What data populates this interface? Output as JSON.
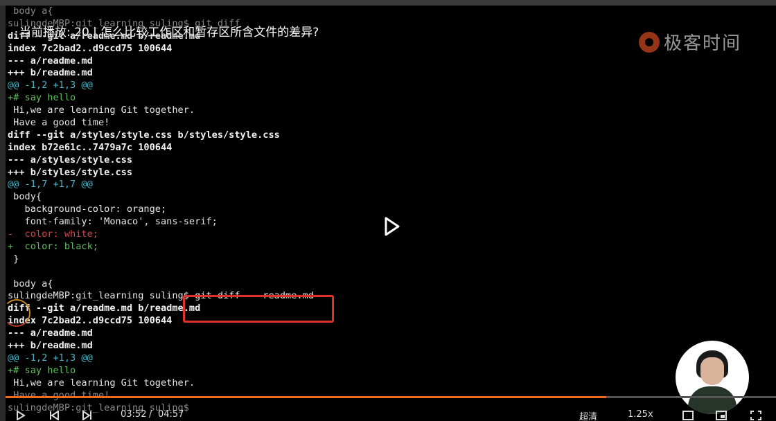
{
  "video": {
    "title": "当前播放: 20 | 怎么比较工作区和暂存区所含文件的差异?",
    "brand": "极客时间",
    "progress": 0.78,
    "current_time": "03:52",
    "duration": "04:57",
    "quality": "超清",
    "speed": "1.25x"
  },
  "terminal": {
    "lines": [
      {
        "text": " body a{",
        "style": "dim"
      },
      {
        "text": "sulingdeMBP:git_learning suling$ git diff",
        "style": "dim"
      },
      {
        "text": "diff --git a/readme.md b/readme.md",
        "style": "bold"
      },
      {
        "text": "index 7c2bad2..d9ccd75 100644",
        "style": "bold"
      },
      {
        "text": "--- a/readme.md",
        "style": "bold"
      },
      {
        "text": "+++ b/readme.md",
        "style": "bold"
      },
      {
        "text": "@@ -1,2 +1,3 @@",
        "style": "hunk"
      },
      {
        "text": "+# say hello",
        "style": "add"
      },
      {
        "text": " Hi,we are learning Git together.",
        "style": "plain"
      },
      {
        "text": " Have a good time!",
        "style": "plain"
      },
      {
        "text": "diff --git a/styles/style.css b/styles/style.css",
        "style": "bold"
      },
      {
        "text": "index b72e61c..7479a7c 100644",
        "style": "bold"
      },
      {
        "text": "--- a/styles/style.css",
        "style": "bold"
      },
      {
        "text": "+++ b/styles/style.css",
        "style": "bold"
      },
      {
        "text": "@@ -1,7 +1,7 @@",
        "style": "hunk"
      },
      {
        "text": " body{",
        "style": "plain"
      },
      {
        "text": "   background-color: orange;",
        "style": "plain"
      },
      {
        "text": "   font-family: 'Monaco', sans-serif;",
        "style": "plain"
      },
      {
        "text": "-  color: white;",
        "style": "del"
      },
      {
        "text": "+  color: black;",
        "style": "add"
      },
      {
        "text": " }",
        "style": "plain"
      },
      {
        "text": "",
        "style": "plain"
      },
      {
        "text": " body a{",
        "style": "plain"
      },
      {
        "text": "sulingdeMBP:git_learning suling$ git diff -- readme.md",
        "style": "plain"
      },
      {
        "text": "diff --git a/readme.md b/readme.md",
        "style": "bold"
      },
      {
        "text": "index 7c2bad2..d9ccd75 100644",
        "style": "bold"
      },
      {
        "text": "--- a/readme.md",
        "style": "bold"
      },
      {
        "text": "+++ b/readme.md",
        "style": "bold"
      },
      {
        "text": "@@ -1,2 +1,3 @@",
        "style": "hunk"
      },
      {
        "text": "+# say hello",
        "style": "add"
      },
      {
        "text": " Hi,we are learning Git together.",
        "style": "plain"
      },
      {
        "text": " Have a good time!",
        "style": "dim"
      },
      {
        "text": "sulingdeMBP:git_learning suling$ ",
        "style": "dim"
      }
    ]
  },
  "colors": {
    "accent": "#f06a1e",
    "highlight": "#e0302a"
  }
}
